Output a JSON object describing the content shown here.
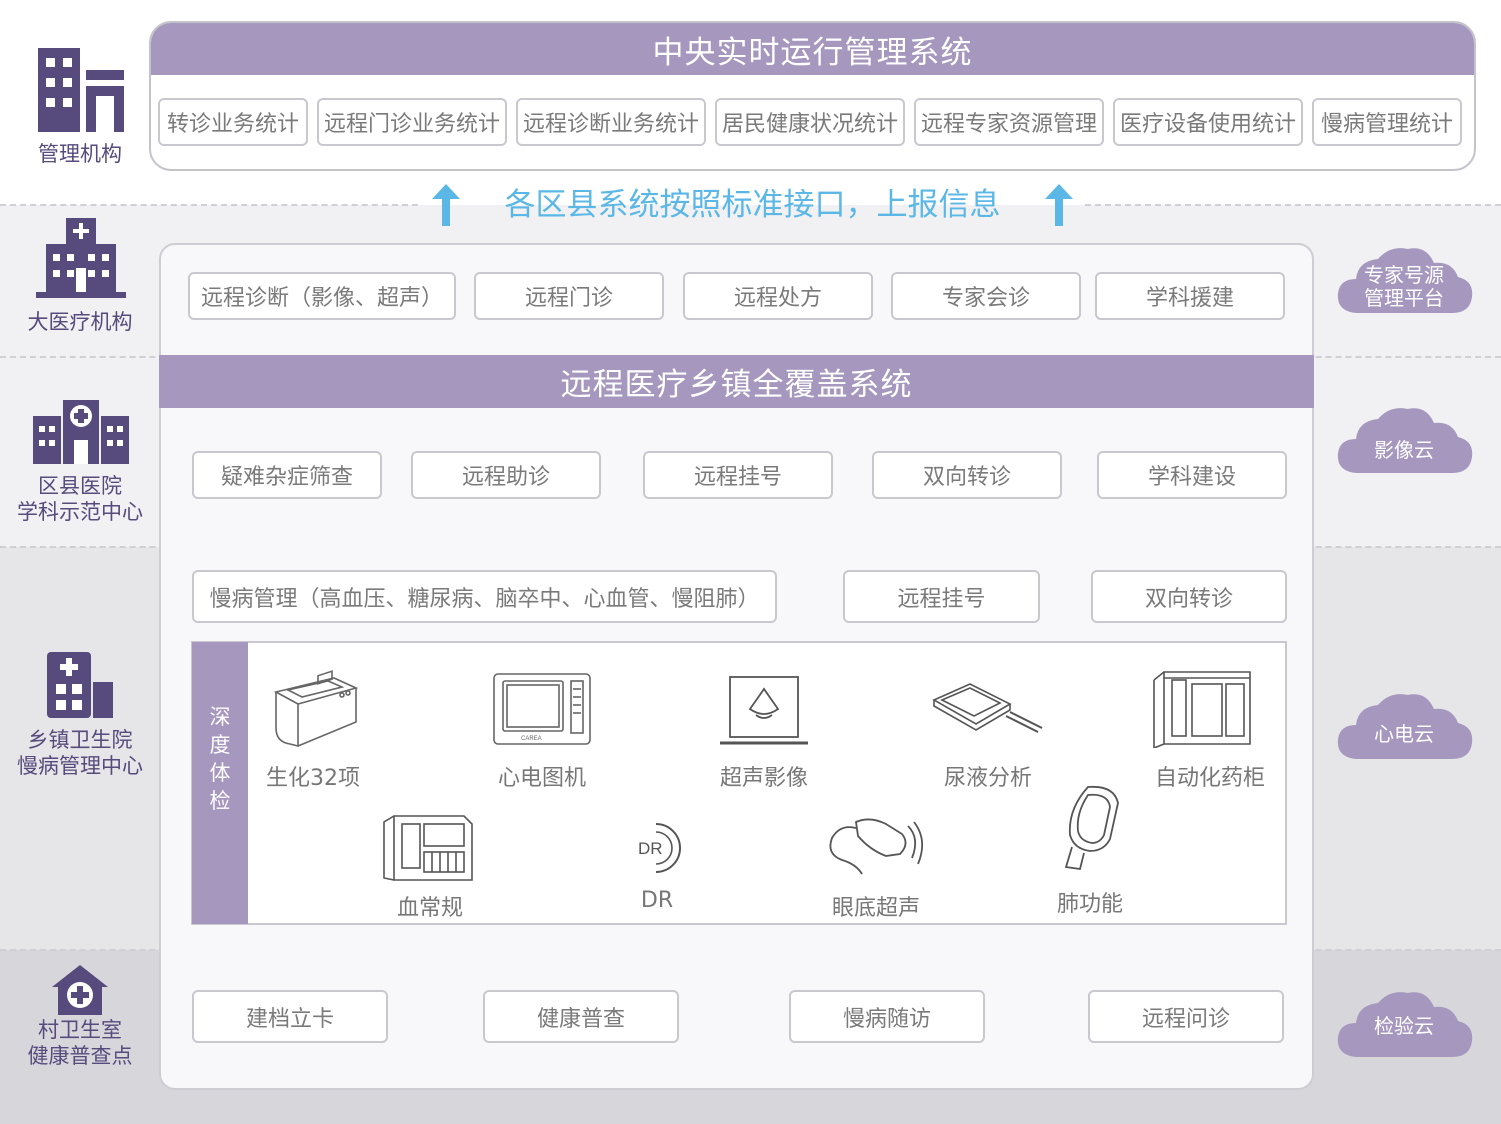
{
  "colors": {
    "purple": "#a597bd",
    "dark_purple": "#574a7c",
    "arrow_blue": "#5ab7e6",
    "band_gray": "#efeff1"
  },
  "central": {
    "title": "中央实时运行管理系统",
    "stats": [
      "转诊业务统计",
      "远程门诊业务统计",
      "远程诊断业务统计",
      "居民健康状况统计",
      "远程专家资源管理",
      "医疗设备使用统计",
      "慢病管理统计"
    ]
  },
  "report_text": "各区县系统按照标准接口，上报信息",
  "roles": {
    "admin": {
      "icon": "office-building-icon",
      "label": "管理机构"
    },
    "large_hospital": {
      "icon": "hospital-icon",
      "label": "大医疗机构"
    },
    "county": {
      "icon": "county-hospital-icon",
      "label1": "区县医院",
      "label2": "学科示范中心"
    },
    "township": {
      "icon": "clinic-icon",
      "label1": "乡镇卫生院",
      "label2": "慢病管理中心"
    },
    "village": {
      "icon": "village-clinic-icon",
      "label1": "村卫生室",
      "label2": "健康普查点"
    }
  },
  "large_hospital_services": [
    "远程诊断（影像、超声）",
    "远程门诊",
    "远程处方",
    "专家会诊",
    "学科援建"
  ],
  "system_title": "远程医疗乡镇全覆盖系统",
  "county_services": [
    "疑难杂症筛查",
    "远程助诊",
    "远程挂号",
    "双向转诊",
    "学科建设"
  ],
  "township_services": [
    "慢病管理（高血压、糖尿病、脑卒中、心血管、慢阻肺）",
    "远程挂号",
    "双向转诊"
  ],
  "deep_exam": {
    "label": [
      "深",
      "度",
      "体",
      "检"
    ],
    "devices": [
      {
        "label": "生化32项",
        "icon": "biochemistry-analyzer-icon"
      },
      {
        "label": "心电图机",
        "icon": "ecg-machine-icon"
      },
      {
        "label": "超声影像",
        "icon": "ultrasound-laptop-icon"
      },
      {
        "label": "尿液分析",
        "icon": "urine-analyzer-icon"
      },
      {
        "label": "自动化药柜",
        "icon": "medicine-cabinet-icon"
      },
      {
        "label": "血常规",
        "icon": "blood-analyzer-icon"
      },
      {
        "label": "DR",
        "icon": "dr-icon",
        "icon_text": "DR"
      },
      {
        "label": "眼底超声",
        "icon": "ultrasound-probe-icon"
      },
      {
        "label": "肺功能",
        "icon": "spirometer-icon"
      }
    ]
  },
  "village_services": [
    "建档立卡",
    "健康普查",
    "慢病随访",
    "远程问诊"
  ],
  "clouds": [
    {
      "line1": "专家号源",
      "line2": "管理平台"
    },
    {
      "line1": "影像云"
    },
    {
      "line1": "心电云"
    },
    {
      "line1": "检验云"
    }
  ]
}
